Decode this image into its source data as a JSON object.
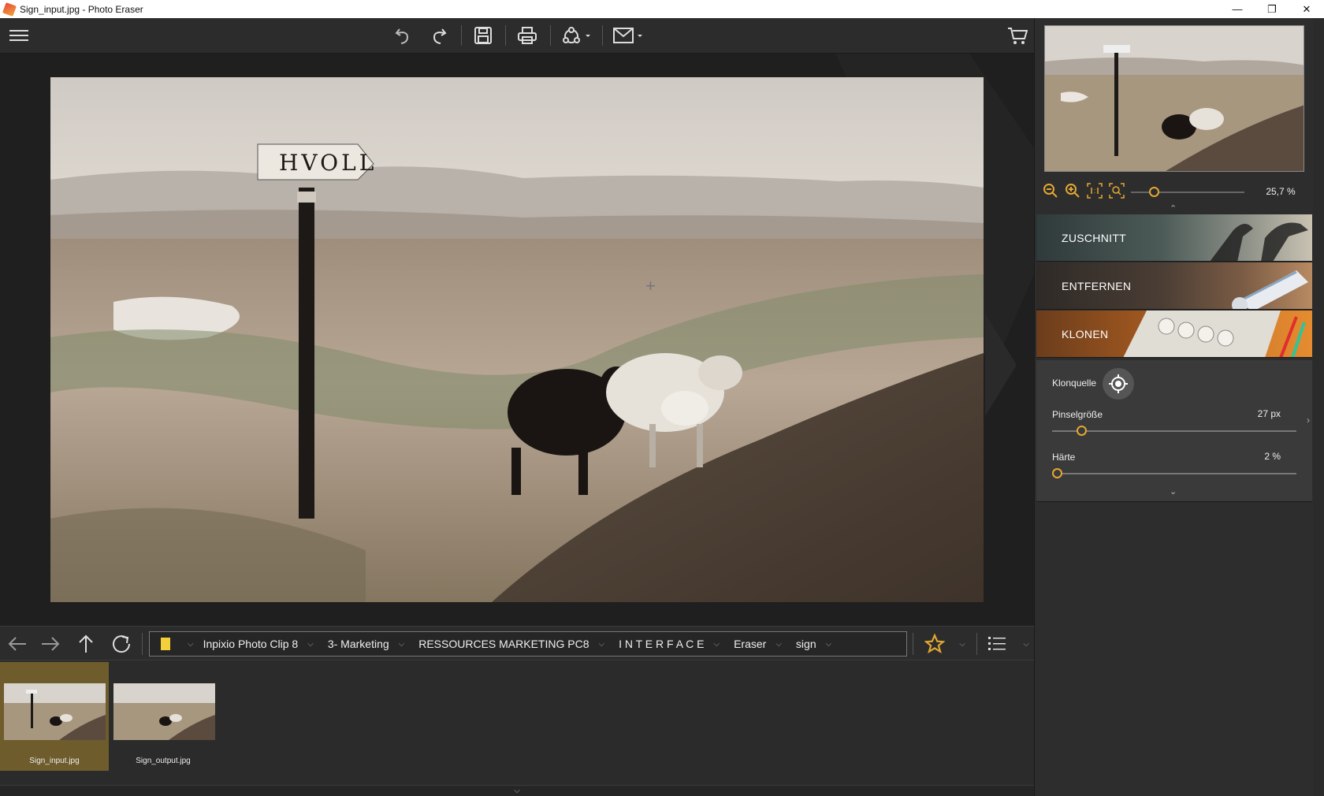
{
  "window": {
    "title": "Sign_input.jpg - Photo Eraser",
    "minimize_icon": "minimize-icon",
    "restore_icon": "restore-icon",
    "close_icon": "close-icon"
  },
  "toolbar": {
    "icons": [
      "menu-icon",
      "undo-icon",
      "redo-icon",
      "save-icon",
      "print-icon",
      "share-icon",
      "export-icon",
      "cart-icon"
    ]
  },
  "image": {
    "sign_text": "HVOLL"
  },
  "navigation": {
    "icons": [
      "back-arrow-icon",
      "forward-arrow-icon",
      "up-arrow-icon",
      "refresh-icon"
    ],
    "breadcrumb": [
      "Inpixio Photo Clip 8",
      "3- Marketing",
      "RESSOURCES MARKETING PC8",
      "I N T E R F A C E",
      "Eraser",
      "sign"
    ],
    "favorites_icon": "star-icon",
    "view_icon": "list-view-icon",
    "accent_color": "#e3a832"
  },
  "filmstrip": {
    "items": [
      {
        "label": "Sign_input.jpg",
        "selected": true
      },
      {
        "label": "Sign_output.jpg",
        "selected": false
      }
    ]
  },
  "panel": {
    "zoom_value": "25,7 %",
    "zoom_level_fraction": 0.2,
    "sections": [
      {
        "label": "ZUSCHNITT",
        "expanded": false
      },
      {
        "label": "ENTFERNEN",
        "expanded": false
      },
      {
        "label": "KLONEN",
        "expanded": true
      }
    ],
    "klonen": {
      "source_label": "Klonquelle",
      "brush_label": "Pinselgröße",
      "brush_value": "27 px",
      "brush_fraction": 0.12,
      "hardness_label": "Härte",
      "hardness_value": "2 %",
      "hardness_fraction": 0.02
    }
  }
}
